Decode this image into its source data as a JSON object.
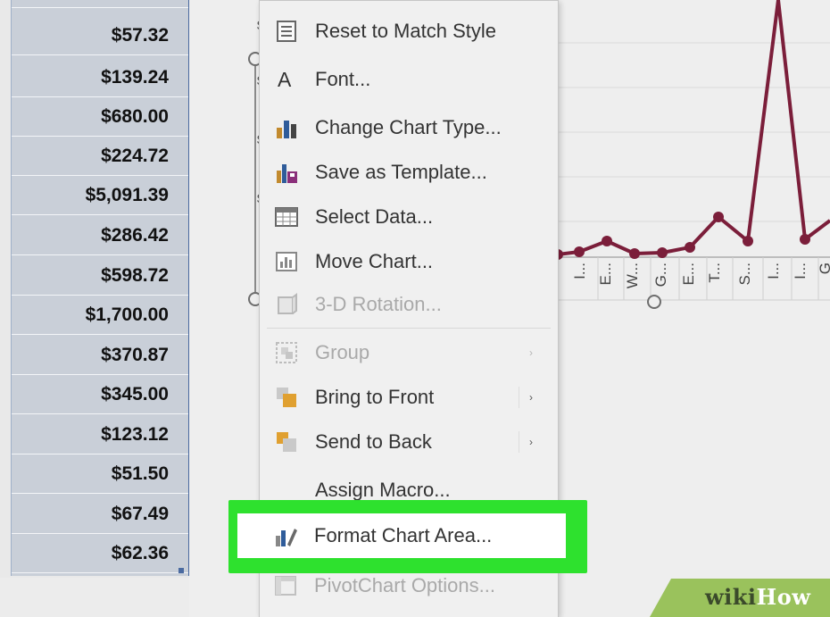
{
  "spreadsheet": {
    "values": [
      "$57.32",
      "$139.24",
      "$680.00",
      "$224.72",
      "$5,091.39",
      "$286.42",
      "$598.72",
      "$1,700.00",
      "$370.87",
      "$345.00",
      "$123.12",
      "$51.50",
      "$67.49",
      "$62.36"
    ]
  },
  "chart": {
    "line_color": "#7b1e3a",
    "x_tick_labels": [
      "I...",
      "E...",
      "W...",
      "G...",
      "E...",
      "T...",
      "S...",
      "I...",
      "I...",
      "G"
    ],
    "axis_labels_partial": [
      "$",
      "$",
      "$",
      "$",
      "$"
    ]
  },
  "menu": {
    "items": [
      {
        "label": "Reset to Match Style",
        "icon": "reset-style-icon",
        "disabled": false,
        "submenu": false
      },
      {
        "label": "Font...",
        "icon": "font-icon",
        "disabled": false,
        "submenu": false
      },
      {
        "label": "Change Chart Type...",
        "icon": "chart-type-icon",
        "disabled": false,
        "submenu": false
      },
      {
        "label": "Save as Template...",
        "icon": "save-template-icon",
        "disabled": false,
        "submenu": false
      },
      {
        "label": "Select Data...",
        "icon": "select-data-icon",
        "disabled": false,
        "submenu": false
      },
      {
        "label": "Move Chart...",
        "icon": "move-chart-icon",
        "disabled": false,
        "submenu": false
      },
      {
        "label": "3-D Rotation...",
        "icon": "rotation-3d-icon",
        "disabled": true,
        "submenu": false
      },
      {
        "label": "Group",
        "icon": "group-icon",
        "disabled": true,
        "submenu": true
      },
      {
        "label": "Bring to Front",
        "icon": "bring-front-icon",
        "disabled": false,
        "submenu": true
      },
      {
        "label": "Send to Back",
        "icon": "send-back-icon",
        "disabled": false,
        "submenu": true
      },
      {
        "label": "Assign Macro...",
        "icon": "",
        "disabled": false,
        "submenu": false
      },
      {
        "label": "Format Chart Area...",
        "icon": "format-chart-area-icon",
        "disabled": false,
        "submenu": false,
        "highlighted": true
      },
      {
        "label": "PivotChart Options...",
        "icon": "pivot-options-icon",
        "disabled": true,
        "submenu": false
      }
    ],
    "submenu_arrow": "›",
    "font_glyph": "A",
    "highlight_color": "#2ee12e"
  },
  "watermark": {
    "text_wiki": "wiki",
    "text_how": "How"
  }
}
